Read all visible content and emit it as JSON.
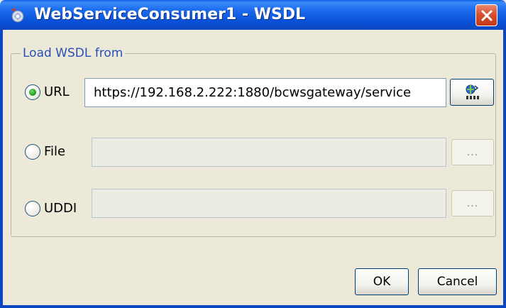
{
  "window": {
    "title": "WebServiceConsumer1 - WSDL",
    "icon": "app-icon",
    "close_icon": "close-icon"
  },
  "group": {
    "legend": "Load WSDL from"
  },
  "options": [
    {
      "label": "URL",
      "selected": true,
      "value": "https://192.168.2.222:1880/bcwsgateway/service",
      "enabled": true,
      "button_icon": "load-network-icon"
    },
    {
      "label": "File",
      "selected": false,
      "value": "",
      "enabled": false,
      "button_label": "..."
    },
    {
      "label": "UDDI",
      "selected": false,
      "value": "",
      "enabled": false,
      "button_label": "..."
    }
  ],
  "footer": {
    "ok_label": "OK",
    "cancel_label": "Cancel"
  }
}
